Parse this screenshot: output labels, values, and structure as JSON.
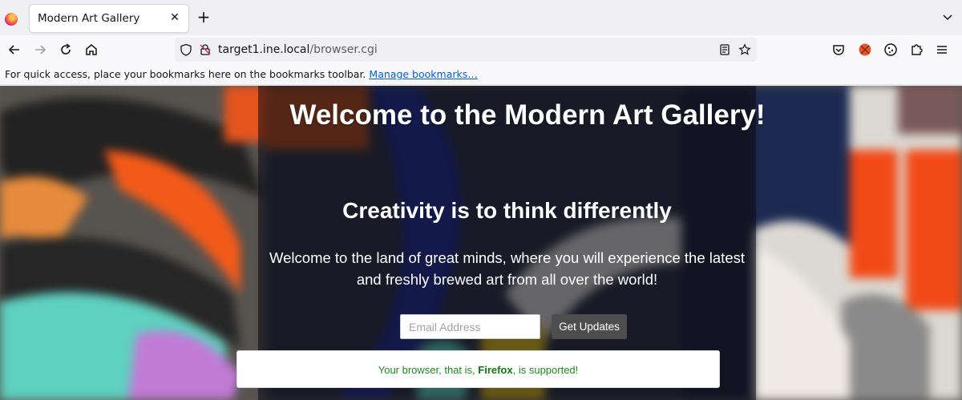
{
  "browser": {
    "tab_title": "Modern Art Gallery",
    "url_host": "target1.ine.local",
    "url_path": "/browser.cgi",
    "bookmarks_text": "For quick access, place your bookmarks here on the bookmarks toolbar.",
    "bookmarks_link": "Manage bookmarks…"
  },
  "page": {
    "headline": "Welcome to the Modern Art Gallery!",
    "subhead": "Creativity is to think differently",
    "intro": "Welcome to the land of great minds, where you will experience the latest and freshly brewed art from all over the world!",
    "email_placeholder": "Email Address",
    "button_label": "Get Updates",
    "notice_prefix": "Your browser, that is, ",
    "notice_browser": "Firefox",
    "notice_suffix": ", is supported!"
  },
  "colors": {
    "accent_link": "#0060df",
    "notice_green": "#198e19",
    "button_bg": "#4d4d4d"
  }
}
